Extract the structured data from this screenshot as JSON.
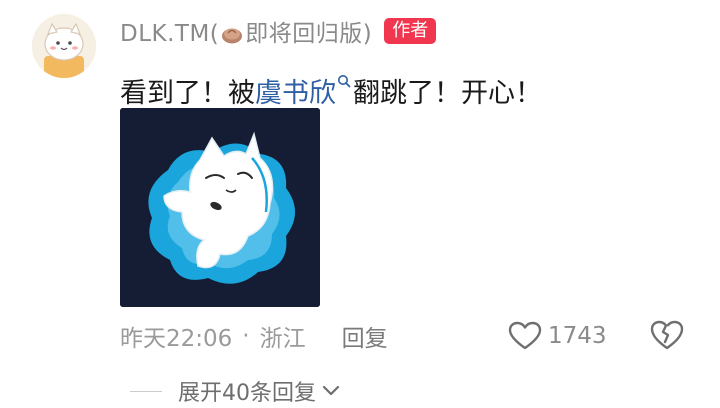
{
  "author": {
    "name_prefix": "DLK.TM(",
    "name_suffix": "即将回归版)",
    "badge": "作者",
    "avatar_icon": "cat-avatar-icon",
    "bun_icon": "bun-emoji-icon"
  },
  "comment": {
    "text_before": "看到了！被",
    "mention": "虞书欣",
    "text_after": "翻跳了！开心！",
    "sticker_icon": "cat-sticker-icon"
  },
  "meta": {
    "time": "昨天22:06",
    "dot": "·",
    "location": "浙江",
    "reply": "回复",
    "likes": "1743"
  },
  "replies": {
    "expand_label": "展开40条回复"
  },
  "colors": {
    "badge": "#f0374f",
    "mention": "#2e5fa5",
    "sticker_bg": "#141d33",
    "sticker_cloud": "#1aa6dd"
  }
}
